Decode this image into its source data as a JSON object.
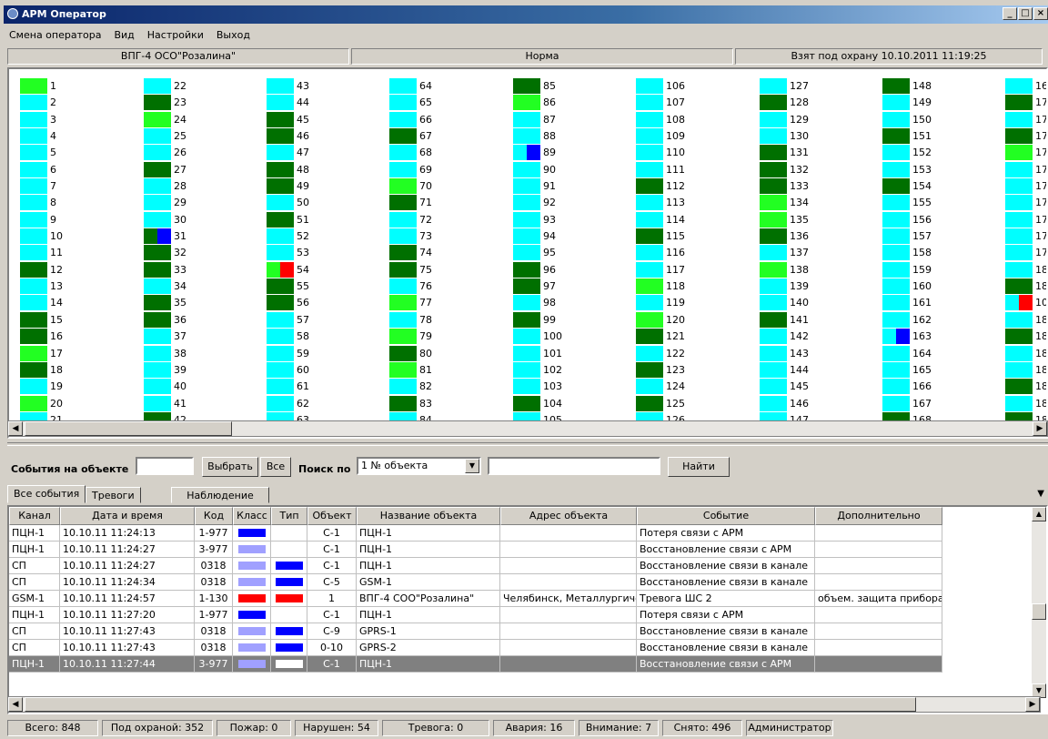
{
  "window": {
    "title": "АРМ Оператор",
    "min": "_",
    "max": "□",
    "close": "×"
  },
  "menu": [
    "Смена оператора",
    "Вид",
    "Настройки",
    "Выход"
  ],
  "status_header": {
    "object": "ВПГ-4 ОСО\"Розалина\"",
    "state": "Норма",
    "armed": "Взят под охрану 10.10.2011 11:19:25"
  },
  "grid": {
    "columns": [
      [
        [
          "1",
          "lg"
        ],
        [
          "2",
          "sp"
        ],
        [
          "3",
          "sp"
        ],
        [
          "4",
          "sp"
        ],
        [
          "5",
          "sp"
        ],
        [
          "6",
          "sp"
        ],
        [
          "7",
          "sp"
        ],
        [
          "8",
          "sp"
        ],
        [
          "9",
          "sp"
        ],
        [
          "10",
          "sp"
        ],
        [
          "11",
          "sp"
        ],
        [
          "12",
          "dk"
        ],
        [
          "13",
          "sp"
        ],
        [
          "14",
          "sp"
        ],
        [
          "15",
          "dk"
        ],
        [
          "16",
          "dk"
        ],
        [
          "17",
          "lg"
        ],
        [
          "18",
          "dk"
        ],
        [
          "19",
          "sp"
        ],
        [
          "20",
          "lg"
        ],
        [
          "21",
          "sp"
        ]
      ],
      [
        [
          "22",
          "sp"
        ],
        [
          "23",
          "dk"
        ],
        [
          "24",
          "lg"
        ],
        [
          "25",
          "sp"
        ],
        [
          "26",
          "sp"
        ],
        [
          "27",
          "dk"
        ],
        [
          "28",
          "sp"
        ],
        [
          "29",
          "sp"
        ],
        [
          "30",
          "sp"
        ],
        [
          "31",
          "dk",
          "blue"
        ],
        [
          "32",
          "dk"
        ],
        [
          "33",
          "dk"
        ],
        [
          "34",
          "sp"
        ],
        [
          "35",
          "dk"
        ],
        [
          "36",
          "dk"
        ],
        [
          "37",
          "sp"
        ],
        [
          "38",
          "sp"
        ],
        [
          "39",
          "sp"
        ],
        [
          "40",
          "sp"
        ],
        [
          "41",
          "sp"
        ],
        [
          "42",
          "dk"
        ]
      ],
      [
        [
          "43",
          "sp"
        ],
        [
          "44",
          "sp"
        ],
        [
          "45",
          "dk"
        ],
        [
          "46",
          "dk"
        ],
        [
          "47",
          "sp"
        ],
        [
          "48",
          "dk"
        ],
        [
          "49",
          "dk"
        ],
        [
          "50",
          "sp"
        ],
        [
          "51",
          "dk"
        ],
        [
          "52",
          "sp"
        ],
        [
          "53",
          "sp"
        ],
        [
          "54",
          "lg",
          "red"
        ],
        [
          "55",
          "dk"
        ],
        [
          "56",
          "dk"
        ],
        [
          "57",
          "sp"
        ],
        [
          "58",
          "sp"
        ],
        [
          "59",
          "sp"
        ],
        [
          "60",
          "sp"
        ],
        [
          "61",
          "sp"
        ],
        [
          "62",
          "sp"
        ],
        [
          "63",
          "sp"
        ]
      ],
      [
        [
          "64",
          "sp"
        ],
        [
          "65",
          "sp"
        ],
        [
          "66",
          "sp"
        ],
        [
          "67",
          "dk"
        ],
        [
          "68",
          "sp"
        ],
        [
          "69",
          "sp"
        ],
        [
          "70",
          "lg"
        ],
        [
          "71",
          "dk"
        ],
        [
          "72",
          "sp"
        ],
        [
          "73",
          "sp"
        ],
        [
          "74",
          "dk"
        ],
        [
          "75",
          "dk"
        ],
        [
          "76",
          "sp"
        ],
        [
          "77",
          "lg"
        ],
        [
          "78",
          "sp"
        ],
        [
          "79",
          "lg"
        ],
        [
          "80",
          "dk"
        ],
        [
          "81",
          "lg"
        ],
        [
          "82",
          "sp"
        ],
        [
          "83",
          "dk"
        ],
        [
          "84",
          "sp"
        ]
      ],
      [
        [
          "85",
          "dk"
        ],
        [
          "86",
          "lg"
        ],
        [
          "87",
          "sp"
        ],
        [
          "88",
          "sp"
        ],
        [
          "89",
          "sp",
          "blue"
        ],
        [
          "90",
          "sp"
        ],
        [
          "91",
          "sp"
        ],
        [
          "92",
          "sp"
        ],
        [
          "93",
          "sp"
        ],
        [
          "94",
          "sp"
        ],
        [
          "95",
          "sp"
        ],
        [
          "96",
          "dk"
        ],
        [
          "97",
          "dk"
        ],
        [
          "98",
          "sp"
        ],
        [
          "99",
          "dk"
        ],
        [
          "100",
          "sp"
        ],
        [
          "101",
          "sp"
        ],
        [
          "102",
          "sp"
        ],
        [
          "103",
          "sp"
        ],
        [
          "104",
          "dk"
        ],
        [
          "105",
          "sp"
        ]
      ],
      [
        [
          "106",
          "sp"
        ],
        [
          "107",
          "sp"
        ],
        [
          "108",
          "sp"
        ],
        [
          "109",
          "sp"
        ],
        [
          "110",
          "sp"
        ],
        [
          "111",
          "sp"
        ],
        [
          "112",
          "dk"
        ],
        [
          "113",
          "sp"
        ],
        [
          "114",
          "sp"
        ],
        [
          "115",
          "dk"
        ],
        [
          "116",
          "sp"
        ],
        [
          "117",
          "sp"
        ],
        [
          "118",
          "lg"
        ],
        [
          "119",
          "sp"
        ],
        [
          "120",
          "lg"
        ],
        [
          "121",
          "dk"
        ],
        [
          "122",
          "sp"
        ],
        [
          "123",
          "dk"
        ],
        [
          "124",
          "sp"
        ],
        [
          "125",
          "dk"
        ],
        [
          "126",
          "sp"
        ]
      ],
      [
        [
          "127",
          "sp"
        ],
        [
          "128",
          "dk"
        ],
        [
          "129",
          "sp"
        ],
        [
          "130",
          "sp"
        ],
        [
          "131",
          "dk"
        ],
        [
          "132",
          "dk"
        ],
        [
          "133",
          "dk"
        ],
        [
          "134",
          "lg"
        ],
        [
          "135",
          "lg"
        ],
        [
          "136",
          "dk"
        ],
        [
          "137",
          "sp"
        ],
        [
          "138",
          "lg"
        ],
        [
          "139",
          "sp"
        ],
        [
          "140",
          "sp"
        ],
        [
          "141",
          "dk"
        ],
        [
          "142",
          "sp"
        ],
        [
          "143",
          "sp"
        ],
        [
          "144",
          "sp"
        ],
        [
          "145",
          "sp"
        ],
        [
          "146",
          "sp"
        ],
        [
          "147",
          "sp"
        ]
      ],
      [
        [
          "148",
          "dk"
        ],
        [
          "149",
          "sp"
        ],
        [
          "150",
          "sp"
        ],
        [
          "151",
          "dk"
        ],
        [
          "152",
          "sp"
        ],
        [
          "153",
          "sp"
        ],
        [
          "154",
          "dk"
        ],
        [
          "155",
          "sp"
        ],
        [
          "156",
          "sp"
        ],
        [
          "157",
          "sp"
        ],
        [
          "158",
          "sp"
        ],
        [
          "159",
          "sp"
        ],
        [
          "160",
          "sp"
        ],
        [
          "161",
          "sp"
        ],
        [
          "162",
          "sp"
        ],
        [
          "163",
          "sp",
          "blue"
        ],
        [
          "164",
          "sp"
        ],
        [
          "165",
          "sp"
        ],
        [
          "166",
          "sp"
        ],
        [
          "167",
          "sp"
        ],
        [
          "168",
          "dk"
        ]
      ],
      [
        [
          "16",
          "sp"
        ],
        [
          "17",
          "dk"
        ],
        [
          "17",
          "sp"
        ],
        [
          "17",
          "dk"
        ],
        [
          "17",
          "lg"
        ],
        [
          "17",
          "sp"
        ],
        [
          "17",
          "sp"
        ],
        [
          "17",
          "sp"
        ],
        [
          "17",
          "sp"
        ],
        [
          "17",
          "sp"
        ],
        [
          "17",
          "sp"
        ],
        [
          "18",
          "sp"
        ],
        [
          "18",
          "dk"
        ],
        [
          "10",
          "sp",
          "red"
        ],
        [
          "18",
          "sp"
        ],
        [
          "18",
          "dk"
        ],
        [
          "18",
          "sp"
        ],
        [
          "18",
          "sp"
        ],
        [
          "18",
          "dk"
        ],
        [
          "18",
          "sp"
        ],
        [
          "18",
          "dk"
        ]
      ]
    ]
  },
  "filter": {
    "events_label": "События на объекте",
    "select_button": "Выбрать",
    "all_button": "Все",
    "search_label": "Поиск по",
    "search_field": "1 № объекта",
    "find_button": "Найти"
  },
  "tabs": [
    "Все события",
    "Тревоги",
    "Наблюдение"
  ],
  "table": {
    "headers": [
      "Канал",
      "Дата и время",
      "Код",
      "Класс",
      "Тип",
      "Объект",
      "Название объекта",
      "Адрес объекта",
      "Событие",
      "Дополнительно"
    ],
    "rows": [
      {
        "ch": "ПЦН-1",
        "dt": "10.10.11  11:24:13",
        "code": "1-977",
        "cls": "#0000ff",
        "type": "",
        "obj": "С-1",
        "name": "ПЦН-1",
        "addr": "",
        "event": "Потеря связи с АРМ",
        "extra": ""
      },
      {
        "ch": "ПЦН-1",
        "dt": "10.10.11  11:24:27",
        "code": "3-977",
        "cls": "#a0a0ff",
        "type": "",
        "obj": "С-1",
        "name": "ПЦН-1",
        "addr": "",
        "event": "Восстановление связи с АРМ",
        "extra": ""
      },
      {
        "ch": "  СП",
        "dt": "10.10.11  11:24:27",
        "code": "0318",
        "cls": "#a0a0ff",
        "type": "#0000ff",
        "obj": "С-1",
        "name": "ПЦН-1",
        "addr": "",
        "event": "Восстановление связи в канале",
        "extra": ""
      },
      {
        "ch": "  СП",
        "dt": "10.10.11  11:24:34",
        "code": "0318",
        "cls": "#a0a0ff",
        "type": "#0000ff",
        "obj": "С-5",
        "name": "GSM-1",
        "addr": "",
        "event": "Восстановление связи в канале",
        "extra": ""
      },
      {
        "ch": "GSM-1",
        "dt": "10.10.11  11:24:57",
        "code": "1-130",
        "cls": "#ff0000",
        "type": "#ff0000",
        "obj": "1",
        "name": "ВПГ-4 СОО\"Розалина\"",
        "addr": "Челябинск, Металлургичес",
        "event": "Тревога ШС 2",
        "extra": "объем. защита прибора и ..."
      },
      {
        "ch": "ПЦН-1",
        "dt": "10.10.11  11:27:20",
        "code": "1-977",
        "cls": "#0000ff",
        "type": "",
        "obj": "С-1",
        "name": "ПЦН-1",
        "addr": "",
        "event": "Потеря связи с АРМ",
        "extra": ""
      },
      {
        "ch": "  СП",
        "dt": "10.10.11  11:27:43",
        "code": "0318",
        "cls": "#a0a0ff",
        "type": "#0000ff",
        "obj": "С-9",
        "name": "GPRS-1",
        "addr": "",
        "event": "Восстановление связи в канале",
        "extra": ""
      },
      {
        "ch": "  СП",
        "dt": "10.10.11  11:27:43",
        "code": "0318",
        "cls": "#a0a0ff",
        "type": "#0000ff",
        "obj": "0-10",
        "name": "GPRS-2",
        "addr": "",
        "event": "Восстановление связи в канале",
        "extra": ""
      },
      {
        "ch": "ПЦН-1",
        "dt": "10.10.11  11:27:44",
        "code": "3-977",
        "cls": "#a0a0ff",
        "type": "#ffffff",
        "obj": "С-1",
        "name": "ПЦН-1",
        "addr": "",
        "event": "Восстановление связи с АРМ",
        "extra": ""
      }
    ],
    "selected_index": 8
  },
  "statusbar": [
    "Всего: 848",
    "Под охраной: 352",
    "Пожар: 0",
    "Нарушен: 54",
    "Тревога: 0",
    "Авария: 16",
    "Внимание: 7",
    "Снято: 496",
    "Администратор"
  ],
  "colors": {
    "cyan": "#00ffff",
    "dark": "#007000",
    "lime": "#22ff22",
    "blue": "#0000ff",
    "red": "#ff0000"
  }
}
